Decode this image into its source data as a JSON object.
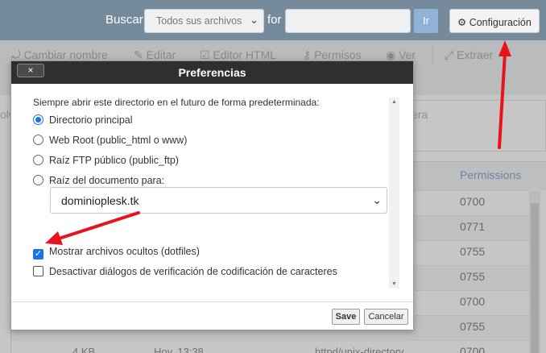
{
  "topbar": {
    "search_label": "Buscar",
    "search_scope": "Todos sus archivos",
    "for_label": "for",
    "search_value": "",
    "go_label": "Ir",
    "settings_label": "Configuración"
  },
  "toolbar": {
    "items": [
      "Cambiar nombre",
      "Editar",
      "Editor HTML",
      "Permisos",
      "Ver",
      "Extraer"
    ]
  },
  "background": {
    "crumb_fragment_left": "olv",
    "crumb_fragment_right": "era",
    "permissions_header": "Permissions",
    "permissions": [
      "0700",
      "0771",
      "0755",
      "0755",
      "0700",
      "0755",
      "0700"
    ],
    "bottom_size": "4 KB",
    "bottom_date": "Hoy, 13:38",
    "bottom_type": "httpd/unix-directory"
  },
  "dialog": {
    "title": "Preferencias",
    "close_label": "×",
    "intro": "Siempre abrir este directorio en el futuro de forma predeterminada:",
    "radio_options": [
      "Directorio principal",
      "Web Root (public_html o www)",
      "Raíz FTP público (public_ftp)",
      "Raíz del documento para:"
    ],
    "selected_radio": "Directorio principal",
    "document_root_value": "dominioplesk.tk",
    "checkboxes": [
      {
        "label": "Mostrar archivos ocultos (dotfiles)",
        "checked": true
      },
      {
        "label": "Desactivar diálogos de verificación de codificación de caracteres",
        "checked": false
      }
    ],
    "save_label": "Save",
    "cancel_label": "Cancelar"
  },
  "colors": {
    "topbar_bg": "#758b9b",
    "accent_blue": "#1a73e8",
    "annotation_red": "#e8141c"
  }
}
